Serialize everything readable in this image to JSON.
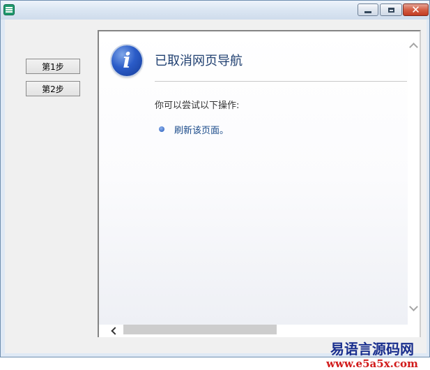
{
  "window": {
    "title": "",
    "controls": {
      "minimize": "minimize",
      "maximize": "maximize",
      "close": "✕"
    }
  },
  "steps": [
    {
      "label": "第1步"
    },
    {
      "label": "第2步"
    }
  ],
  "browser": {
    "page_title": "已取消网页导航",
    "subtitle": "你可以尝试以下操作:",
    "actions": [
      {
        "label": "刷新该页面。"
      }
    ],
    "info_icon_glyph": "i"
  },
  "watermark": {
    "title": "易语言源码网",
    "url": "www.e5a5x.com"
  },
  "colors": {
    "title_text": "#1f3f70",
    "link_text": "#1a4a8a",
    "watermark_title": "#1a2f8e",
    "watermark_url": "#d11a1a"
  },
  "icons": [
    "app-icon",
    "minimize-icon",
    "maximize-icon",
    "close-icon",
    "info-icon",
    "bullet-icon",
    "scroll-up-icon",
    "scroll-down-icon",
    "scroll-left-icon"
  ]
}
